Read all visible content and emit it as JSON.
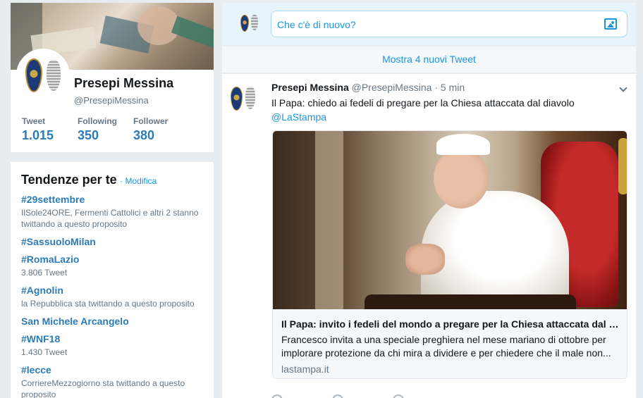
{
  "profile": {
    "name": "Presepi Messina",
    "handle": "@PresepiMessina",
    "stats": [
      {
        "label": "Tweet",
        "value": "1.015"
      },
      {
        "label": "Following",
        "value": "350"
      },
      {
        "label": "Follower",
        "value": "380"
      }
    ]
  },
  "trends": {
    "title": "Tendenze per te",
    "edit_label": "· Modifica",
    "items": [
      {
        "name": "#29settembre",
        "sub": "IlSole24ORE, Fermenti Cattolici e altri 2 stanno twittando a questo proposito"
      },
      {
        "name": "#SassuoloMilan",
        "sub": ""
      },
      {
        "name": "#RomaLazio",
        "sub": "3.806 Tweet"
      },
      {
        "name": "#Agnolin",
        "sub": "la Repubblica sta twittando a questo proposito"
      },
      {
        "name": "San Michele Arcangelo",
        "sub": ""
      },
      {
        "name": "#WNF18",
        "sub": "1.430 Tweet"
      },
      {
        "name": "#lecce",
        "sub": "CorriereMezzogiorno sta twittando a questo proposito"
      }
    ]
  },
  "compose": {
    "placeholder": "Che c'è di nuovo?"
  },
  "timeline": {
    "new_tweets_label": "Mostra 4 nuovi Tweet"
  },
  "tweet": {
    "author": "Presepi Messina",
    "handle": "@PresepiMessina",
    "separator": " · ",
    "time": "5 min",
    "text": "Il Papa: chiedo ai fedeli di pregare per la Chiesa attaccata dal diavolo",
    "mention": "@LaStampa",
    "card": {
      "title": "Il Papa: invito i fedeli del mondo a pregare per la Chiesa attaccata dal diavolo",
      "description": "Francesco invita a una speciale preghiera nel mese mariano di ottobre per implorare protezione da chi mira a dividere e per chiedere che il male non...",
      "domain": "lastampa.it"
    }
  },
  "colors": {
    "accent": "#1b95e0",
    "background": "#e6ecf0",
    "muted": "#657786"
  }
}
